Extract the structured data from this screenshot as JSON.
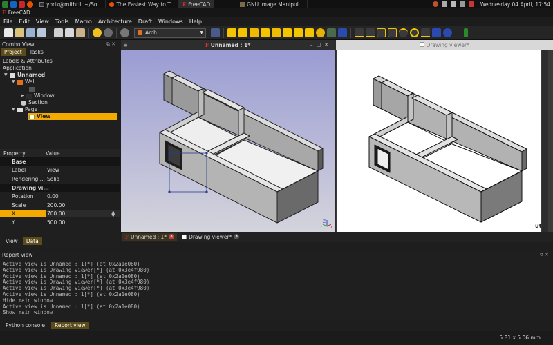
{
  "taskbar": {
    "tasks": [
      {
        "label": "yorik@mithril: ~/So..."
      },
      {
        "label": "The Easiest Way to T..."
      },
      {
        "label": "FreeCAD"
      },
      {
        "label": "GNU Image Manipul..."
      }
    ],
    "clock": "Wednesday 04 April, 17:54"
  },
  "window": {
    "title": "FreeCAD"
  },
  "menu": [
    "File",
    "Edit",
    "View",
    "Tools",
    "Macro",
    "Architecture",
    "Draft",
    "Windows",
    "Help"
  ],
  "toolbar": {
    "workbench": "Arch"
  },
  "combo": {
    "title": "Combo View",
    "tabs": [
      "Project",
      "Tasks"
    ],
    "labels_header": "Labels & Attributes",
    "application": "Application",
    "tree": {
      "doc": "Unnamed",
      "wall": "Wall",
      "window": "Window",
      "section": "Section",
      "page": "Page",
      "view": "View"
    },
    "prop_header": {
      "property": "Property",
      "value": "Value"
    },
    "props": [
      {
        "k": "Base",
        "v": "",
        "group": true
      },
      {
        "k": "Label",
        "v": "View"
      },
      {
        "k": "Rendering ...",
        "v": "Solid"
      },
      {
        "k": "Drawing vi...",
        "v": "",
        "group": true
      },
      {
        "k": "Rotation",
        "v": "0.00"
      },
      {
        "k": "Scale",
        "v": "200.00"
      },
      {
        "k": "X",
        "v": "700.00",
        "hl": true
      },
      {
        "k": "Y",
        "v": "500.00"
      }
    ],
    "bottom_tabs": [
      "View",
      "Data"
    ]
  },
  "views": {
    "model_title": "Unnamed : 1*",
    "drawing_title": "Drawing viewer*"
  },
  "mdi_tabs": [
    {
      "label": "Unnamed : 1*"
    },
    {
      "label": "Drawing viewer*"
    }
  ],
  "report": {
    "title": "Report view",
    "lines": [
      "Active view is Unnamed : 1[*] (at 0x2a1e080)",
      "Active view is Drawing viewer[*] (at 0x3e4f980)",
      "Active view is Unnamed : 1[*] (at 0x2a1e080)",
      "Active view is Drawing viewer[*] (at 0x3e4f980)",
      "Active view is Drawing viewer[*] (at 0x3e4f980)",
      "Active view is Unnamed : 1[*] (at 0x2a1e080)",
      "Hide main window",
      "Active view is Unnamed : 1[*] (at 0x2a1e080)",
      "Show main window"
    ],
    "tabs": [
      "Python console",
      "Report view"
    ]
  },
  "status": {
    "dimensions": "5.81 x 5.06 mm"
  },
  "axis_labels": {
    "x": "X",
    "y": "Y",
    "z": "Z"
  },
  "drawing_corner": "ut"
}
